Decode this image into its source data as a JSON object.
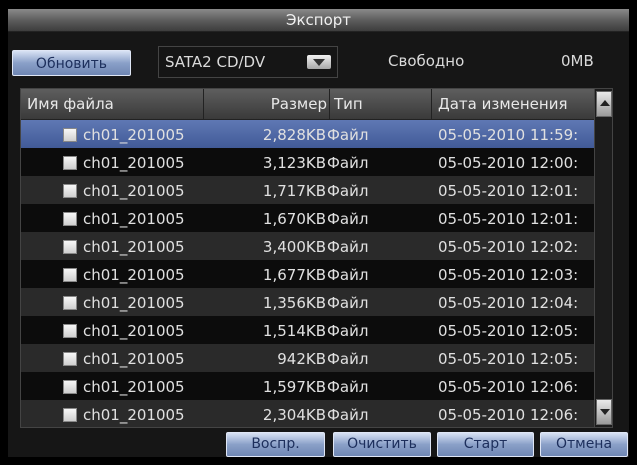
{
  "window": {
    "title": "Экспорт"
  },
  "toolbar": {
    "refresh_label": "Обновить",
    "device": "SATA2 CD/DV",
    "free_label": "Свободно",
    "free_value": "0MB"
  },
  "table": {
    "columns": [
      "Имя файла",
      "Размер",
      "Тип",
      "Дата изменения"
    ],
    "rows": [
      {
        "name": "ch01_201005",
        "size": "2,828KB",
        "type": "Файл",
        "date": "05-05-2010 11:59:",
        "selected": true
      },
      {
        "name": "ch01_201005",
        "size": "3,123KB",
        "type": "Файл",
        "date": "05-05-2010 12:00:"
      },
      {
        "name": "ch01_201005",
        "size": "1,717KB",
        "type": "Файл",
        "date": "05-05-2010 12:01:"
      },
      {
        "name": "ch01_201005",
        "size": "1,670KB",
        "type": "Файл",
        "date": "05-05-2010 12:01:"
      },
      {
        "name": "ch01_201005",
        "size": "3,400KB",
        "type": "Файл",
        "date": "05-05-2010 12:02:"
      },
      {
        "name": "ch01_201005",
        "size": "1,677KB",
        "type": "Файл",
        "date": "05-05-2010 12:03:"
      },
      {
        "name": "ch01_201005",
        "size": "1,356KB",
        "type": "Файл",
        "date": "05-05-2010 12:04:"
      },
      {
        "name": "ch01_201005",
        "size": "1,514KB",
        "type": "Файл",
        "date": "05-05-2010 12:05:"
      },
      {
        "name": "ch01_201005",
        "size": "942KB",
        "type": "Файл",
        "date": "05-05-2010 12:05:"
      },
      {
        "name": "ch01_201005",
        "size": "1,597KB",
        "type": "Файл",
        "date": "05-05-2010 12:06:"
      },
      {
        "name": "ch01_201005",
        "size": "2,304KB",
        "type": "Файл",
        "date": "05-05-2010 12:06:"
      }
    ]
  },
  "footer": {
    "play_label": "Воспр.",
    "clear_label": "Очистить",
    "start_label": "Старт",
    "cancel_label": "Отмена"
  },
  "colors": {
    "selected_row": "#4f68a5",
    "button_text": "#1d2f5c"
  },
  "icons": {
    "row_checkbox": "checkbox-icon",
    "dropdown": "chevron-down-icon",
    "scroll_up": "chevron-up-icon",
    "scroll_down": "chevron-down-icon"
  }
}
